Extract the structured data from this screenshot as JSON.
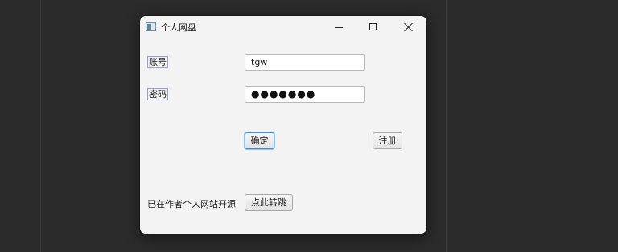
{
  "window": {
    "title": "个人网盘",
    "icon": "app-window-icon",
    "controls": {
      "minimize": "minimize-icon",
      "maximize": "maximize-icon",
      "close": "close-icon"
    }
  },
  "form": {
    "account_label": "账号",
    "account_value": "tgw",
    "password_label": "密码",
    "password_value": "●●●●●●●",
    "confirm_label": "确定",
    "register_label": "注册"
  },
  "footer": {
    "text": "已在作者个人网站开源",
    "jump_label": "点此转跳"
  },
  "colors": {
    "background": "#2b2b2b",
    "window": "#f3f3f3",
    "focus_border": "#3f8fd6"
  }
}
